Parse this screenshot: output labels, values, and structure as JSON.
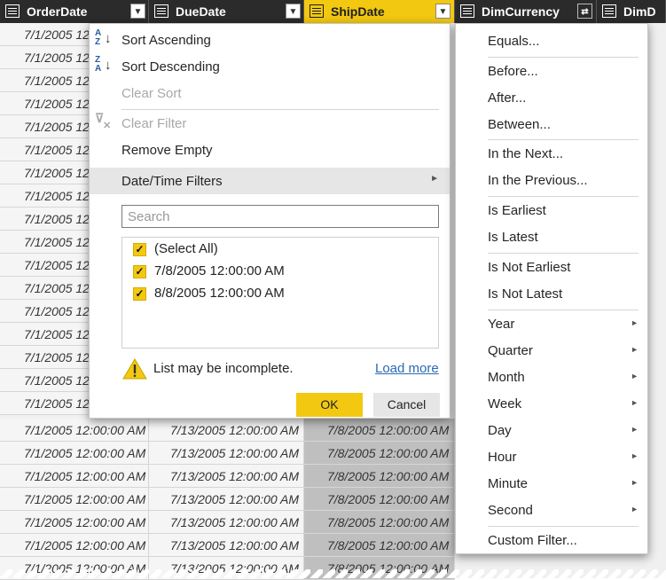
{
  "columns": [
    {
      "name": "OrderDate"
    },
    {
      "name": "DueDate"
    },
    {
      "name": "ShipDate"
    },
    {
      "name": "DimCurrency"
    },
    {
      "name": "DimD"
    }
  ],
  "row_values": {
    "order_truncated": "7/1/2005 12",
    "order": "7/1/2005 12:00:00 AM",
    "due": "7/13/2005 12:00:00 AM",
    "ship": "7/8/2005 12:00:00 AM"
  },
  "main_menu": {
    "sort_ascending": "Sort Ascending",
    "sort_descending": "Sort Descending",
    "clear_sort": "Clear Sort",
    "clear_filter": "Clear Filter",
    "remove_empty": "Remove Empty",
    "datetime_filters": "Date/Time Filters",
    "search_placeholder": "Search",
    "items": [
      "(Select All)",
      "7/8/2005 12:00:00 AM",
      "8/8/2005 12:00:00 AM"
    ],
    "warning": "List may be incomplete.",
    "load_more": "Load more",
    "ok": "OK",
    "cancel": "Cancel"
  },
  "sub_menu": {
    "items": [
      "Equals...",
      "Before...",
      "After...",
      "Between...",
      "In the Next...",
      "In the Previous...",
      "Is Earliest",
      "Is Latest",
      "Is Not Earliest",
      "Is Not Latest",
      "Year",
      "Quarter",
      "Month",
      "Week",
      "Day",
      "Hour",
      "Minute",
      "Second",
      "Custom Filter..."
    ]
  },
  "colors": {
    "accent": "#f2c811",
    "header_bg": "#2b2b2b",
    "link": "#2a6ab5"
  }
}
